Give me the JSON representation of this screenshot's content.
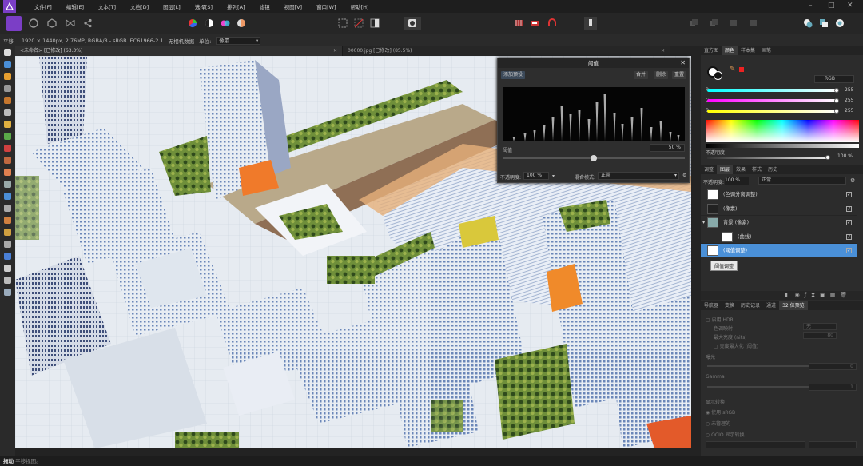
{
  "menu": [
    "文件[F]",
    "编辑[E]",
    "文本[T]",
    "文档[D]",
    "图层[L]",
    "选择[S]",
    "排列[A]",
    "滤镜",
    "视图[V]",
    "窗口[W]",
    "帮助[H]"
  ],
  "context": {
    "tool": "平移",
    "info": "1920 × 1440px, 2.76MP, RGBA/8 - sRGB IEC61966-2.1",
    "meta": "无相机数据",
    "unit_label": "单位:",
    "unit_value": "像素"
  },
  "tabs": [
    {
      "label": "<未命名> [已修改] (63.3%)"
    },
    {
      "label": "00000.jpg [已修改] (85.5%)"
    }
  ],
  "dialog": {
    "title": "阈值",
    "preset_btn": "添加预设",
    "merge_btn": "合并",
    "delete_btn": "删除",
    "reset_btn": "重置",
    "threshold_label": "阈值",
    "threshold_value": "50 %",
    "opacity_label": "不透明度:",
    "opacity_value": "100 %",
    "blend_label": "混合模式:",
    "blend_value": "正常"
  },
  "colors": {
    "tabs": [
      "直方图",
      "颜色",
      "样本集",
      "画笔"
    ],
    "mode": "RGB",
    "r_label": "R:",
    "g_label": "G:",
    "b_label": "B:",
    "r": "255",
    "g": "255",
    "b": "255",
    "opacity_label": "不透明度",
    "opacity_value": "100 %"
  },
  "layers_panel": {
    "tabs": [
      "调整",
      "图层",
      "效果",
      "样式",
      "历史"
    ],
    "opacity_label": "不透明度:",
    "opacity_value": "100 %",
    "blend_value": "正常",
    "items": [
      {
        "name": "(色调分离调整)"
      },
      {
        "name": "(像素)"
      },
      {
        "name": "背景 (像素)"
      },
      {
        "name": "(曲线)"
      },
      {
        "name": "(阈值调整)"
      }
    ],
    "tooltip": "阈值调整"
  },
  "bottom_panel": {
    "tabs": [
      "导航器",
      "变换",
      "历史记录",
      "通道",
      "32 位预览"
    ],
    "hdr": "启用 HDR",
    "hdr_opt1": "色调映射",
    "hdr_opt1_value": "无",
    "hdr_opt2": "最大亮度 (nits)",
    "hdr_opt2_value": "80",
    "hdr_opt3": "亮度最大化 (阈值)",
    "exposure": "曝光",
    "exposure_value": "0",
    "gamma": "Gamma",
    "gamma_value": "1",
    "display": "显示转换",
    "opt_srgb": "使用 sRGB",
    "opt_none": "未管理的",
    "opt_ocio": "OCIO 显示转换"
  },
  "status": {
    "bold": "拖动",
    "rest": "平移视图。"
  }
}
